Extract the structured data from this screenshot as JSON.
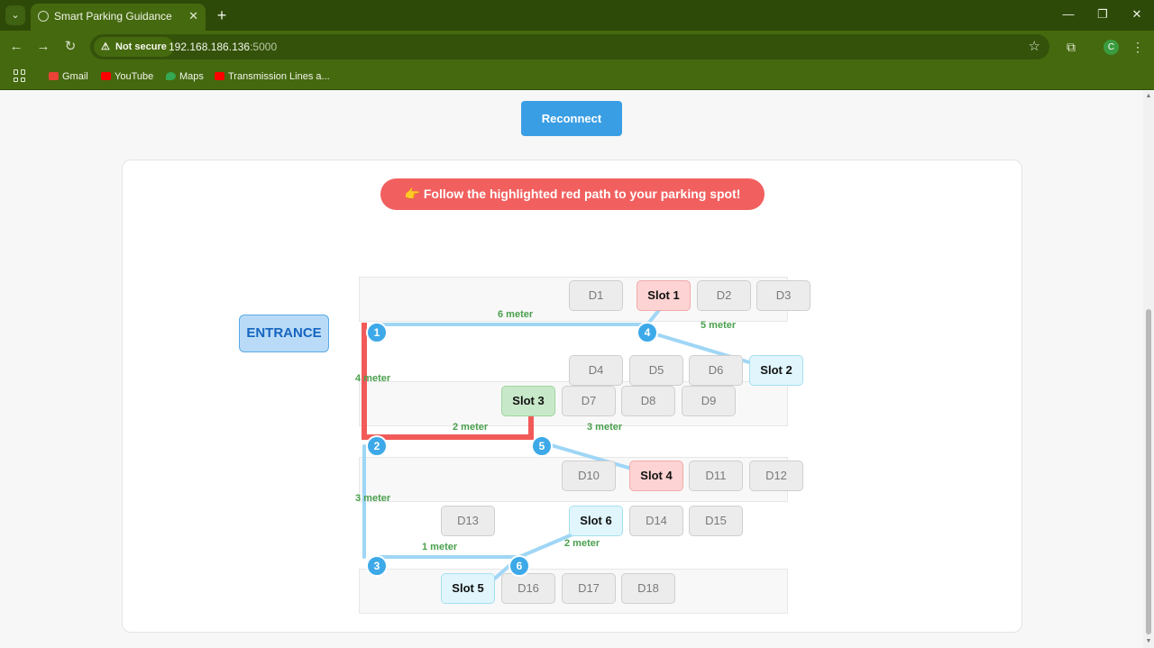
{
  "browser": {
    "tab_title": "Smart Parking Guidance System",
    "security_label": "Not secure",
    "url_host": "192.168.186.136",
    "url_port": ":5000",
    "avatar_letter": "C",
    "bookmarks": [
      {
        "label": "Gmail",
        "icon": "gmail-icon",
        "color": "#ea4335"
      },
      {
        "label": "YouTube",
        "icon": "youtube-icon",
        "color": "#ff0000"
      },
      {
        "label": "Maps",
        "icon": "maps-icon",
        "color": "#34a853"
      },
      {
        "label": "Transmission Lines a...",
        "icon": "youtube-icon",
        "color": "#ff0000"
      }
    ]
  },
  "page": {
    "reconnect_label": "Reconnect",
    "banner_text": "👉 Follow the highlighted red path to your parking spot!",
    "entrance_label": "ENTRANCE"
  },
  "colors": {
    "accent_blue": "#3a9ee4",
    "route_red": "#f25a5a",
    "path_blue": "#9fd6f5",
    "node_blue": "#3da9e8",
    "distance_green": "#4aa04d"
  },
  "slots": [
    {
      "id": "D1",
      "state": "empty"
    },
    {
      "id": "Slot 1",
      "state": "occupied-red"
    },
    {
      "id": "D2",
      "state": "empty"
    },
    {
      "id": "D3",
      "state": "empty"
    },
    {
      "id": "D4",
      "state": "empty"
    },
    {
      "id": "D5",
      "state": "empty"
    },
    {
      "id": "D6",
      "state": "empty"
    },
    {
      "id": "Slot 2",
      "state": "available-cyan"
    },
    {
      "id": "Slot 3",
      "state": "target-green"
    },
    {
      "id": "D7",
      "state": "empty"
    },
    {
      "id": "D8",
      "state": "empty"
    },
    {
      "id": "D9",
      "state": "empty"
    },
    {
      "id": "D10",
      "state": "empty"
    },
    {
      "id": "Slot 4",
      "state": "occupied-red"
    },
    {
      "id": "D11",
      "state": "empty"
    },
    {
      "id": "D12",
      "state": "empty"
    },
    {
      "id": "D13",
      "state": "empty"
    },
    {
      "id": "Slot 6",
      "state": "available-cyan"
    },
    {
      "id": "D14",
      "state": "empty"
    },
    {
      "id": "D15",
      "state": "empty"
    },
    {
      "id": "Slot 5",
      "state": "available-cyan"
    },
    {
      "id": "D16",
      "state": "empty"
    },
    {
      "id": "D17",
      "state": "empty"
    },
    {
      "id": "D18",
      "state": "empty"
    }
  ],
  "nodes": [
    "1",
    "2",
    "3",
    "4",
    "5",
    "6"
  ],
  "distances": [
    "6 meter",
    "5 meter",
    "4 meter",
    "2 meter",
    "3 meter",
    "3 meter",
    "1 meter",
    "2 meter"
  ]
}
